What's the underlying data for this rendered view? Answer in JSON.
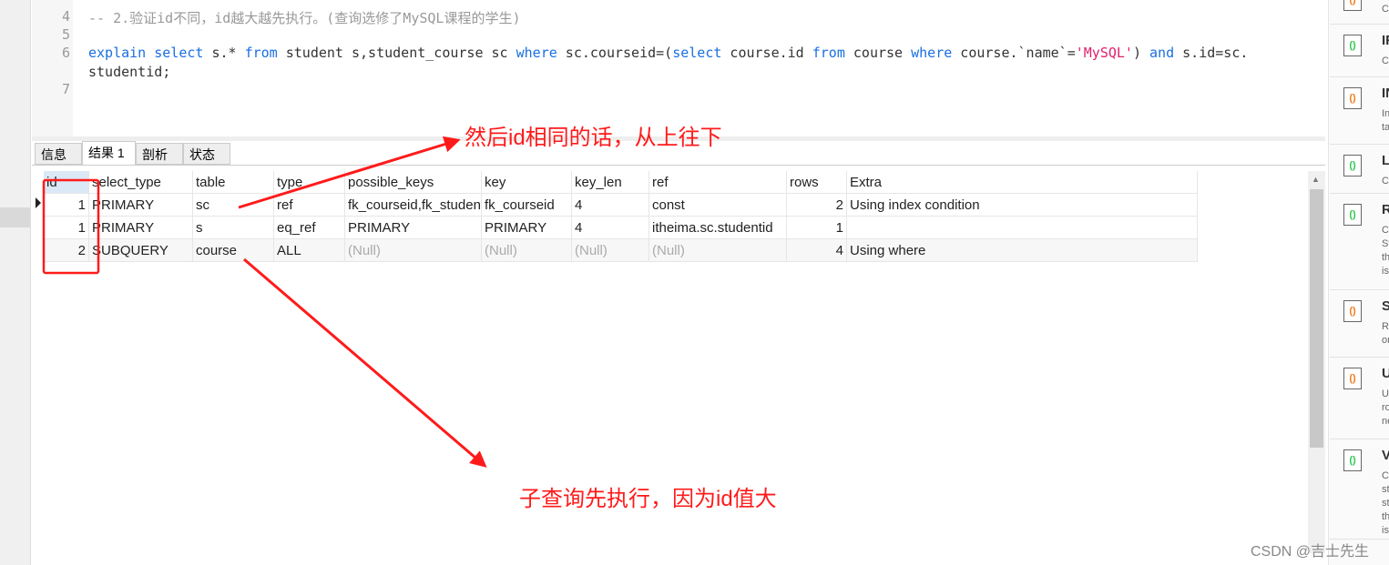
{
  "editor": {
    "lines": [
      {
        "num": "4",
        "parts": [
          {
            "t": "-- 2.验证id不同，id越大越先执行。(查询选修了MySQL课程的学生)",
            "c": "cm"
          }
        ]
      },
      {
        "num": "5",
        "parts": []
      },
      {
        "num": "6",
        "parts": [
          {
            "t": "explain",
            "c": "kw"
          },
          {
            "t": " "
          },
          {
            "t": "select",
            "c": "kw"
          },
          {
            "t": " s.* "
          },
          {
            "t": "from",
            "c": "kw"
          },
          {
            "t": " student s,student_course sc "
          },
          {
            "t": "where",
            "c": "kw"
          },
          {
            "t": " sc.courseid=("
          },
          {
            "t": "select",
            "c": "kw"
          },
          {
            "t": " course.id "
          },
          {
            "t": "from",
            "c": "kw"
          },
          {
            "t": " course "
          },
          {
            "t": "where",
            "c": "kw"
          },
          {
            "t": " course.`name`="
          },
          {
            "t": "'MySQL'",
            "c": "str"
          },
          {
            "t": ") "
          },
          {
            "t": "and",
            "c": "kw"
          },
          {
            "t": " s.id=sc."
          }
        ]
      },
      {
        "num": "",
        "parts": [
          {
            "t": "studentid;"
          }
        ]
      },
      {
        "num": "7",
        "parts": []
      }
    ]
  },
  "tabs": [
    "信息",
    "结果 1",
    "剖析",
    "状态"
  ],
  "active_tab": 1,
  "grid": {
    "columns": [
      "id",
      "select_type",
      "table",
      "type",
      "possible_keys",
      "key",
      "key_len",
      "ref",
      "rows",
      "Extra"
    ],
    "rows": [
      [
        "1",
        "PRIMARY",
        "sc",
        "ref",
        "fk_courseid,fk_studentid",
        "fk_courseid",
        "4",
        "const",
        "2",
        "Using index condition"
      ],
      [
        "1",
        "PRIMARY",
        "s",
        "eq_ref",
        "PRIMARY",
        "PRIMARY",
        "4",
        "itheima.sc.studentid",
        "1",
        ""
      ],
      [
        "2",
        "SUBQUERY",
        "course",
        "ALL",
        "(Null)",
        "(Null)",
        "(Null)",
        "(Null)",
        "4",
        "Using where"
      ]
    ]
  },
  "right_panel": {
    "items": [
      {
        "title": "",
        "sub": [
          "Cr"
        ],
        "icon": "multi"
      },
      {
        "title": "IF",
        "sub": [
          "Cr"
        ],
        "icon": "green"
      },
      {
        "title": "IN",
        "sub": [
          "In",
          "ta"
        ],
        "icon": "multi"
      },
      {
        "title": "L",
        "sub": [
          "Cr"
        ],
        "icon": "green"
      },
      {
        "title": "R",
        "sub": [
          "Cr",
          "St",
          "th",
          "is"
        ],
        "icon": "green"
      },
      {
        "title": "S",
        "sub": [
          "Re",
          "or"
        ],
        "icon": "multi"
      },
      {
        "title": "U",
        "sub": [
          "U",
          "ro",
          "ne"
        ],
        "icon": "multi"
      },
      {
        "title": "V",
        "sub": [
          "Cr",
          "st",
          "st",
          "th",
          "is"
        ],
        "icon": "green"
      }
    ]
  },
  "annotations": {
    "top": "然后id相同的话，从上往下",
    "bottom": "子查询先执行，因为id值大"
  },
  "watermark": "CSDN @吉士先生",
  "colors": {
    "annotation": "#ff1a1a",
    "keyword": "#1a6fe0",
    "string": "#e0206a"
  }
}
